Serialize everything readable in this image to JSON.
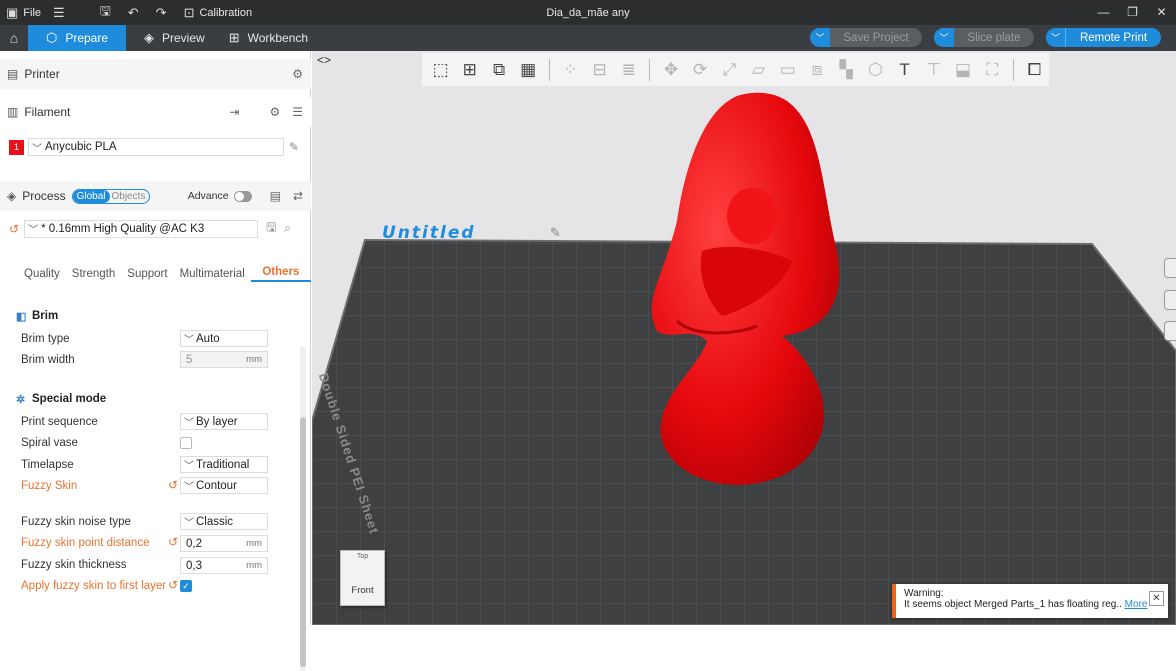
{
  "titlebar": {
    "file_label": "File",
    "calibration_label": "Calibration",
    "window_title": "Dia_da_mãe any"
  },
  "tabs": {
    "prepare": "Prepare",
    "preview": "Preview",
    "workbench": "Workbench"
  },
  "actions": {
    "save_project": "Save Project",
    "slice_plate": "Slice plate",
    "remote_print": "Remote Print"
  },
  "printer": {
    "title": "Printer"
  },
  "filament": {
    "title": "Filament",
    "slot_number": "1",
    "slot_color": "#e8101a",
    "name": "Anycubic PLA"
  },
  "process": {
    "title": "Process",
    "global_label": "Global",
    "objects_label": "Objects",
    "advance_label": "Advance",
    "preset": "* 0.16mm High Quality @AC K3"
  },
  "subtabs": [
    "Quality",
    "Strength",
    "Support",
    "Multimaterial",
    "Others"
  ],
  "brim": {
    "title": "Brim",
    "type_label": "Brim type",
    "type_value": "Auto",
    "width_label": "Brim width",
    "width_value": "5",
    "width_unit": "mm"
  },
  "special": {
    "title": "Special mode",
    "print_sequence_label": "Print sequence",
    "print_sequence_value": "By layer",
    "spiral_vase_label": "Spiral vase",
    "timelapse_label": "Timelapse",
    "timelapse_value": "Traditional",
    "fuzzy_skin_label": "Fuzzy Skin",
    "fuzzy_skin_value": "Contour",
    "noise_type_label": "Fuzzy skin noise type",
    "noise_type_value": "Classic",
    "point_distance_label": "Fuzzy skin point distance",
    "point_distance_value": "0,2",
    "thickness_label": "Fuzzy skin thickness",
    "thickness_value": "0,3",
    "first_layer_label": "Apply fuzzy skin to first layer",
    "unit_mm": "mm"
  },
  "viewport": {
    "plate_name": "Untitled",
    "sheet_label": "Double Sided PEI Sheet",
    "cube_front": "Front",
    "cube_top": "Top",
    "model_color": "#e5080d"
  },
  "warning": {
    "title": "Warning:",
    "message": "It seems object Merged Parts_1 has floating reg..",
    "more": "More"
  },
  "colors": {
    "accent": "#1f8cdb",
    "modified": "#e87330"
  }
}
